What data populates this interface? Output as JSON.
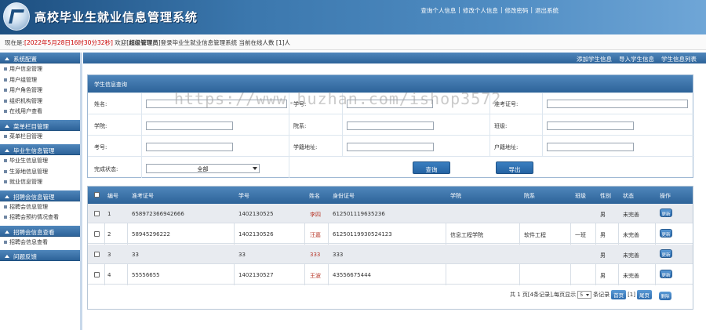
{
  "header": {
    "title": "高校毕业生就业信息管理系统",
    "links": [
      "查询个人信息",
      "修改个人信息",
      "修改密码",
      "退出系统"
    ]
  },
  "status": {
    "prefix": "现在是:",
    "datetime": "[2022年5月28日16时30分32秒]",
    "welcome": " 欢迎[",
    "role": "超级管理员",
    "suffix": "]登录毕业生就业信息管理系统 当前在线人数 [1]人"
  },
  "sidebar": {
    "sections": [
      {
        "title": "系统配置",
        "items": [
          "用户信息管理",
          "用户组管理",
          "用户角色管理",
          "组织机构管理",
          "在线用户查看"
        ]
      },
      {
        "title": "菜单栏目管理",
        "items": [
          "菜单栏目管理"
        ]
      },
      {
        "title": "毕业生信息管理",
        "items": [
          "毕业生信息管理",
          "生源地信息管理",
          "就业信息管理"
        ]
      },
      {
        "title": "招聘会信息管理",
        "items": [
          "招聘会信息管理",
          "招聘会预约情况查看"
        ]
      },
      {
        "title": "招聘会信息查看",
        "items": [
          "招聘会信息查看"
        ]
      },
      {
        "title": "问题反馈",
        "items": []
      }
    ]
  },
  "topbar": {
    "links": [
      "添加学生信息",
      "导入学生信息",
      "学生信息列表"
    ]
  },
  "query": {
    "title": "学生信息查询",
    "labels": {
      "name": "姓名:",
      "student_no": "学号:",
      "exam_no": "准考证号:",
      "college": "学院:",
      "department": "院系:",
      "class": "班级:",
      "exam_id": "考号:",
      "hukou": "学籍地址:",
      "origin": "户籍地址:",
      "status": "完成状态:"
    },
    "status_value": "全部",
    "search_btn": "查询",
    "export_btn": "导出"
  },
  "table": {
    "headers": [
      "编号",
      "准考证号",
      "学号",
      "姓名",
      "身份证号",
      "学院",
      "院系",
      "班级",
      "性别",
      "状态",
      "操作"
    ],
    "rows": [
      {
        "no": "1",
        "exam": "658972366942666",
        "sid": "1402130525",
        "name": "李四",
        "idcard": "612501119635236",
        "college": "",
        "dept": "",
        "class": "",
        "gender": "男",
        "status": "未完善",
        "op": "更新"
      },
      {
        "no": "2",
        "exam": "58945296222",
        "sid": "1402130526",
        "name": "汪嘉",
        "idcard": "612501199305241​23",
        "college": "信息工程学院",
        "dept": "软件工程",
        "class": "一班",
        "gender": "男",
        "status": "未完善",
        "op": "更新"
      },
      {
        "no": "3",
        "exam": "33",
        "sid": "33",
        "name": "333",
        "idcard": "333",
        "college": "",
        "dept": "",
        "class": "",
        "gender": "男",
        "status": "未完善",
        "op": "更新"
      },
      {
        "no": "4",
        "exam": "55556655",
        "sid": "1402130527",
        "name": "王波",
        "idcard": "43556675444",
        "college": "",
        "dept": "",
        "class": "",
        "gender": "男",
        "status": "未完善",
        "op": "更新"
      }
    ],
    "pager": {
      "text1": "共 1 页[4条记录],每页显示",
      "per_page": "5",
      "text2": "条记录",
      "first": "首页",
      "current": "[1]",
      "last": "尾页",
      "delete": "删除"
    }
  },
  "watermark": "https://www.huzhan.com/ishop3572"
}
